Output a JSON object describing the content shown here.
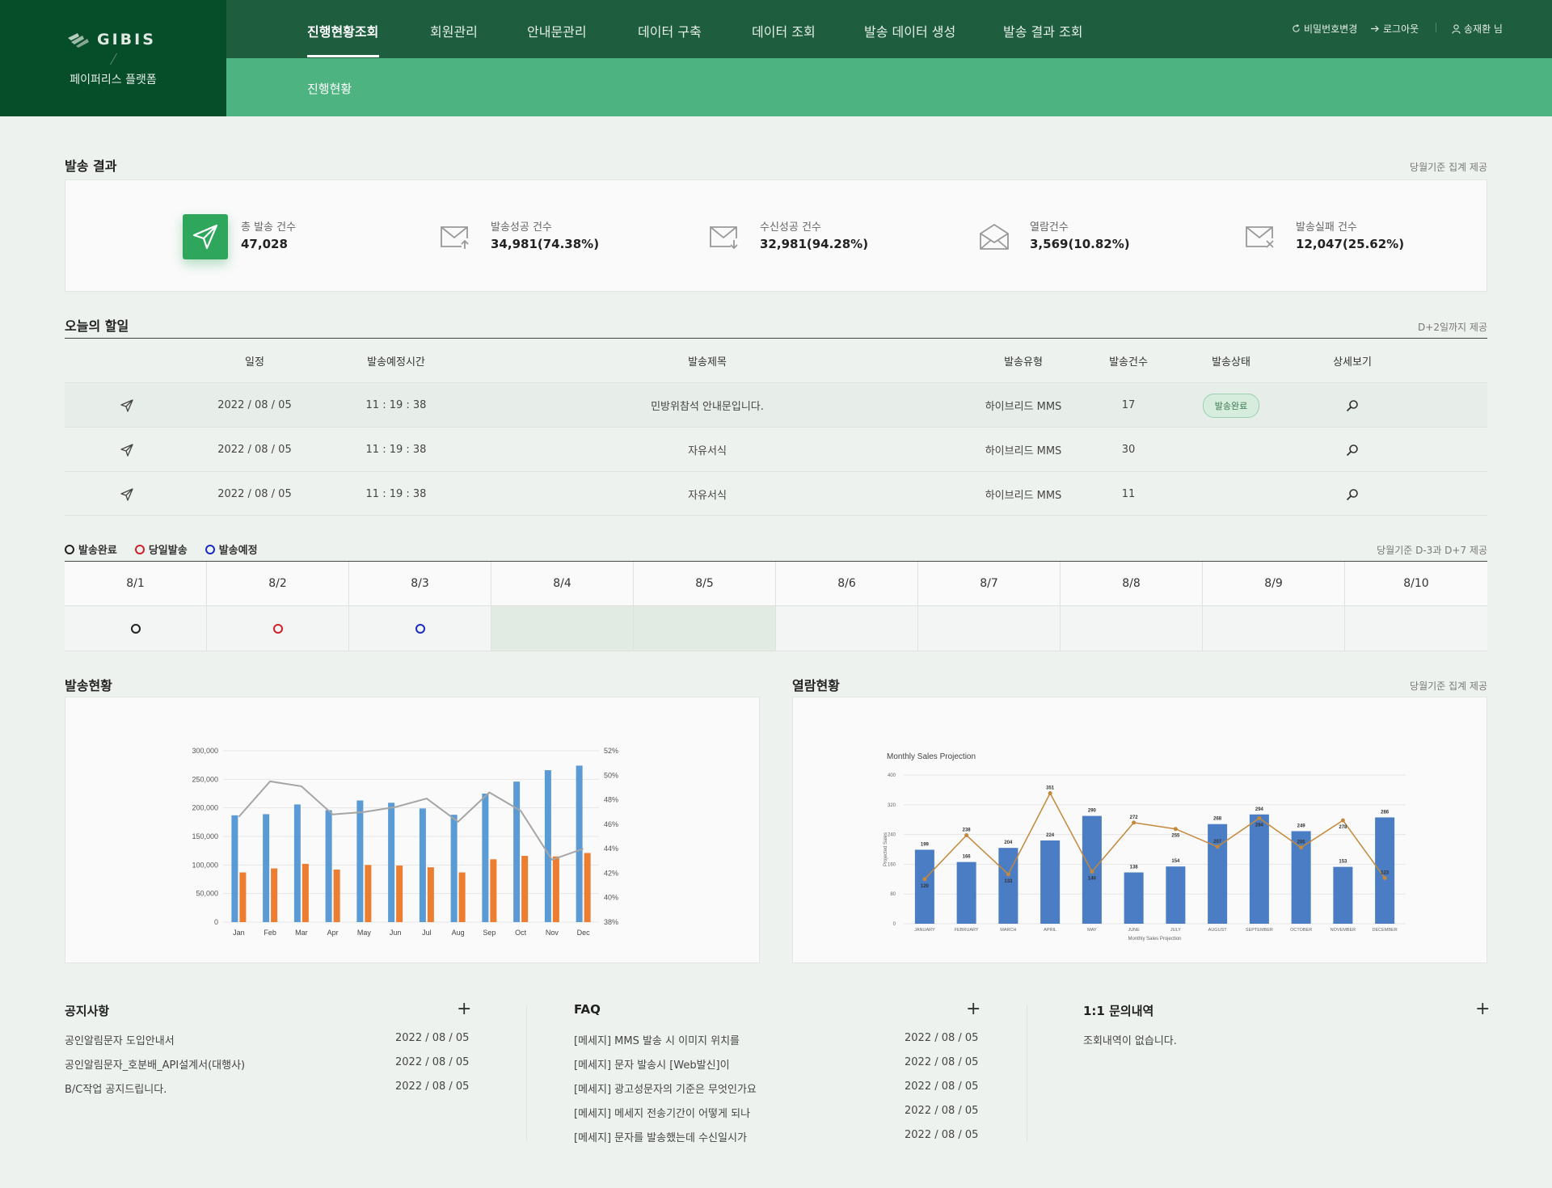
{
  "header": {
    "brand": "GIBIS",
    "platform": "페이퍼리스 플랫폼",
    "nav": [
      "진행현황조회",
      "회원관리",
      "안내문관리",
      "데이터 구축",
      "데이터 조회",
      "발송 데이터 생성",
      "발송 결과 조회"
    ],
    "active_nav": 0,
    "change_password": "비밀번호변경",
    "logout": "로그아웃",
    "user": "송재환 님",
    "subnav": "진행현황"
  },
  "send_result": {
    "title": "발송 결과",
    "note": "당월기준 집계 제공",
    "stats": [
      {
        "label": "총 발송 건수",
        "value": "47,028",
        "icon": "paper-plane-icon"
      },
      {
        "label": "발송성공 건수",
        "value": "34,981(74.38%)",
        "icon": "mail-sent-icon"
      },
      {
        "label": "수신성공 건수",
        "value": "32,981(94.28%)",
        "icon": "mail-received-icon"
      },
      {
        "label": "열람건수",
        "value": "3,569(10.82%)",
        "icon": "mail-open-icon"
      },
      {
        "label": "발송실패 건수",
        "value": "12,047(25.62%)",
        "icon": "mail-failed-icon"
      }
    ]
  },
  "todo": {
    "title": "오늘의 할일",
    "note": "D+2일까지 제공",
    "columns": [
      "일정",
      "발송예정시간",
      "발송제목",
      "발송유형",
      "발송건수",
      "발송상태",
      "상세보기"
    ],
    "rows": [
      {
        "date": "2022 / 08 / 05",
        "time": "11 : 19 : 38",
        "subject": "민방위참석 안내문입니다.",
        "type": "하이브리드 MMS",
        "count": "17",
        "status": "발송완료"
      },
      {
        "date": "2022 / 08 / 05",
        "time": "11 : 19 : 38",
        "subject": "자유서식",
        "type": "하이브리드 MMS",
        "count": "30",
        "status": ""
      },
      {
        "date": "2022 / 08 / 05",
        "time": "11 : 19 : 38",
        "subject": "자유서식",
        "type": "하이브리드 MMS",
        "count": "11",
        "status": ""
      }
    ]
  },
  "calendar": {
    "legend": [
      {
        "label": "발송완료",
        "color": "#222222"
      },
      {
        "label": "당일발송",
        "color": "#d0202a"
      },
      {
        "label": "발송예정",
        "color": "#1a2bc4"
      }
    ],
    "note": "당월기준 D-3과 D+7 제공",
    "dates": [
      "8/1",
      "8/2",
      "8/3",
      "8/4",
      "8/5",
      "8/6",
      "8/7",
      "8/8",
      "8/9",
      "8/10"
    ],
    "marks": [
      "done",
      "today",
      "planned",
      "",
      "",
      "",
      "",
      "",
      "",
      ""
    ],
    "filled": [
      false,
      false,
      false,
      true,
      true,
      false,
      false,
      false,
      false,
      false
    ]
  },
  "send_status": {
    "title": "발송현황"
  },
  "open_status": {
    "title": "열람현황",
    "note": "당월기준 집계 제공"
  },
  "chart_data": [
    {
      "type": "bar",
      "categories": [
        "Jan",
        "Feb",
        "Mar",
        "Apr",
        "May",
        "Jun",
        "Jul",
        "Aug",
        "Sep",
        "Oct",
        "Nov",
        "Dec"
      ],
      "series": [
        {
          "values": [
            187000,
            189000,
            206000,
            196000,
            213000,
            209000,
            199000,
            188000,
            225000,
            246000,
            266000,
            274000
          ],
          "color": "#5b9bd5"
        },
        {
          "values": [
            87000,
            94000,
            102000,
            92000,
            100000,
            99000,
            96000,
            87000,
            110000,
            116000,
            115000,
            121000
          ],
          "color": "#ed7d31"
        },
        {
          "type": "line",
          "axis": "right",
          "values": [
            46.6,
            49.5,
            49.1,
            46.8,
            47.0,
            47.4,
            48.1,
            46.2,
            48.6,
            47.1,
            43.1,
            44.0
          ],
          "color": "#a5a5a5"
        }
      ],
      "ylim": [
        0,
        300000
      ],
      "yticks": [
        "0",
        "50,000",
        "100,000",
        "150,000",
        "200,000",
        "250,000",
        "300,000"
      ],
      "y2lim": [
        38,
        52
      ],
      "y2ticks": [
        "38%",
        "40%",
        "42%",
        "44%",
        "46%",
        "48%",
        "50%",
        "52%"
      ]
    },
    {
      "type": "bar",
      "title": "Monthly Sales Projection",
      "categories": [
        "JANUARY",
        "FEBRUARY",
        "MARCH",
        "APRIL",
        "MAY",
        "JUNE",
        "JULY",
        "AUGUST",
        "SEPTEMBER",
        "OCTOBER",
        "NOVEMBER",
        "DECEMBER"
      ],
      "series": [
        {
          "values": [
            199,
            166,
            204,
            224,
            290,
            138,
            154,
            268,
            294,
            249,
            153,
            286
          ],
          "color": "#4a7dc4",
          "labels": [
            "199",
            "166",
            "204",
            "224",
            "290",
            "138",
            "154",
            "268",
            "294",
            "249",
            "153",
            "286"
          ]
        },
        {
          "type": "line",
          "values": [
            120,
            238,
            133,
            351,
            140,
            272,
            255,
            207,
            284,
            205,
            278,
            123
          ],
          "color": "#c4883a",
          "labels": [
            "120",
            "238",
            "133",
            "351",
            "140",
            "272",
            "255",
            "207",
            "284",
            "205",
            "278",
            "123"
          ]
        }
      ],
      "xlabel": "Monthly Sales Projection",
      "ylabel": "Projected Sales",
      "ylim": [
        0,
        400
      ],
      "yticks": [
        "0",
        "80",
        "160",
        "240",
        "320",
        "400"
      ]
    }
  ],
  "notice": {
    "title": "공지사항",
    "items": [
      {
        "text": "공인알림문자 도입안내서",
        "date": "2022 / 08 / 05"
      },
      {
        "text": "공인알림문자_호분배_API설계서(대행사)",
        "date": "2022 / 08 / 05"
      },
      {
        "text": "B/C작업 공지드립니다.",
        "date": "2022 / 08 / 05"
      }
    ]
  },
  "faq": {
    "title": "FAQ",
    "items": [
      {
        "text": "[메세지] MMS 발송 시 이미지 위치를",
        "date": "2022 / 08 / 05"
      },
      {
        "text": "[메세지] 문자 발송시 [Web발신]이",
        "date": "2022 / 08 / 05"
      },
      {
        "text": "[메세지] 광고성문자의 기준은 무엇인가요",
        "date": "2022 / 08 / 05"
      },
      {
        "text": "[메세지] 메세지 전송기간이 어떻게 되나",
        "date": "2022 / 08 / 05"
      },
      {
        "text": "[메세지] 문자를 발송했는데 수신일시가",
        "date": "2022 / 08 / 05"
      }
    ]
  },
  "inquiry": {
    "title": "1:1 문의내역",
    "empty": "조회내역이 없습니다."
  },
  "plus_label": "+"
}
